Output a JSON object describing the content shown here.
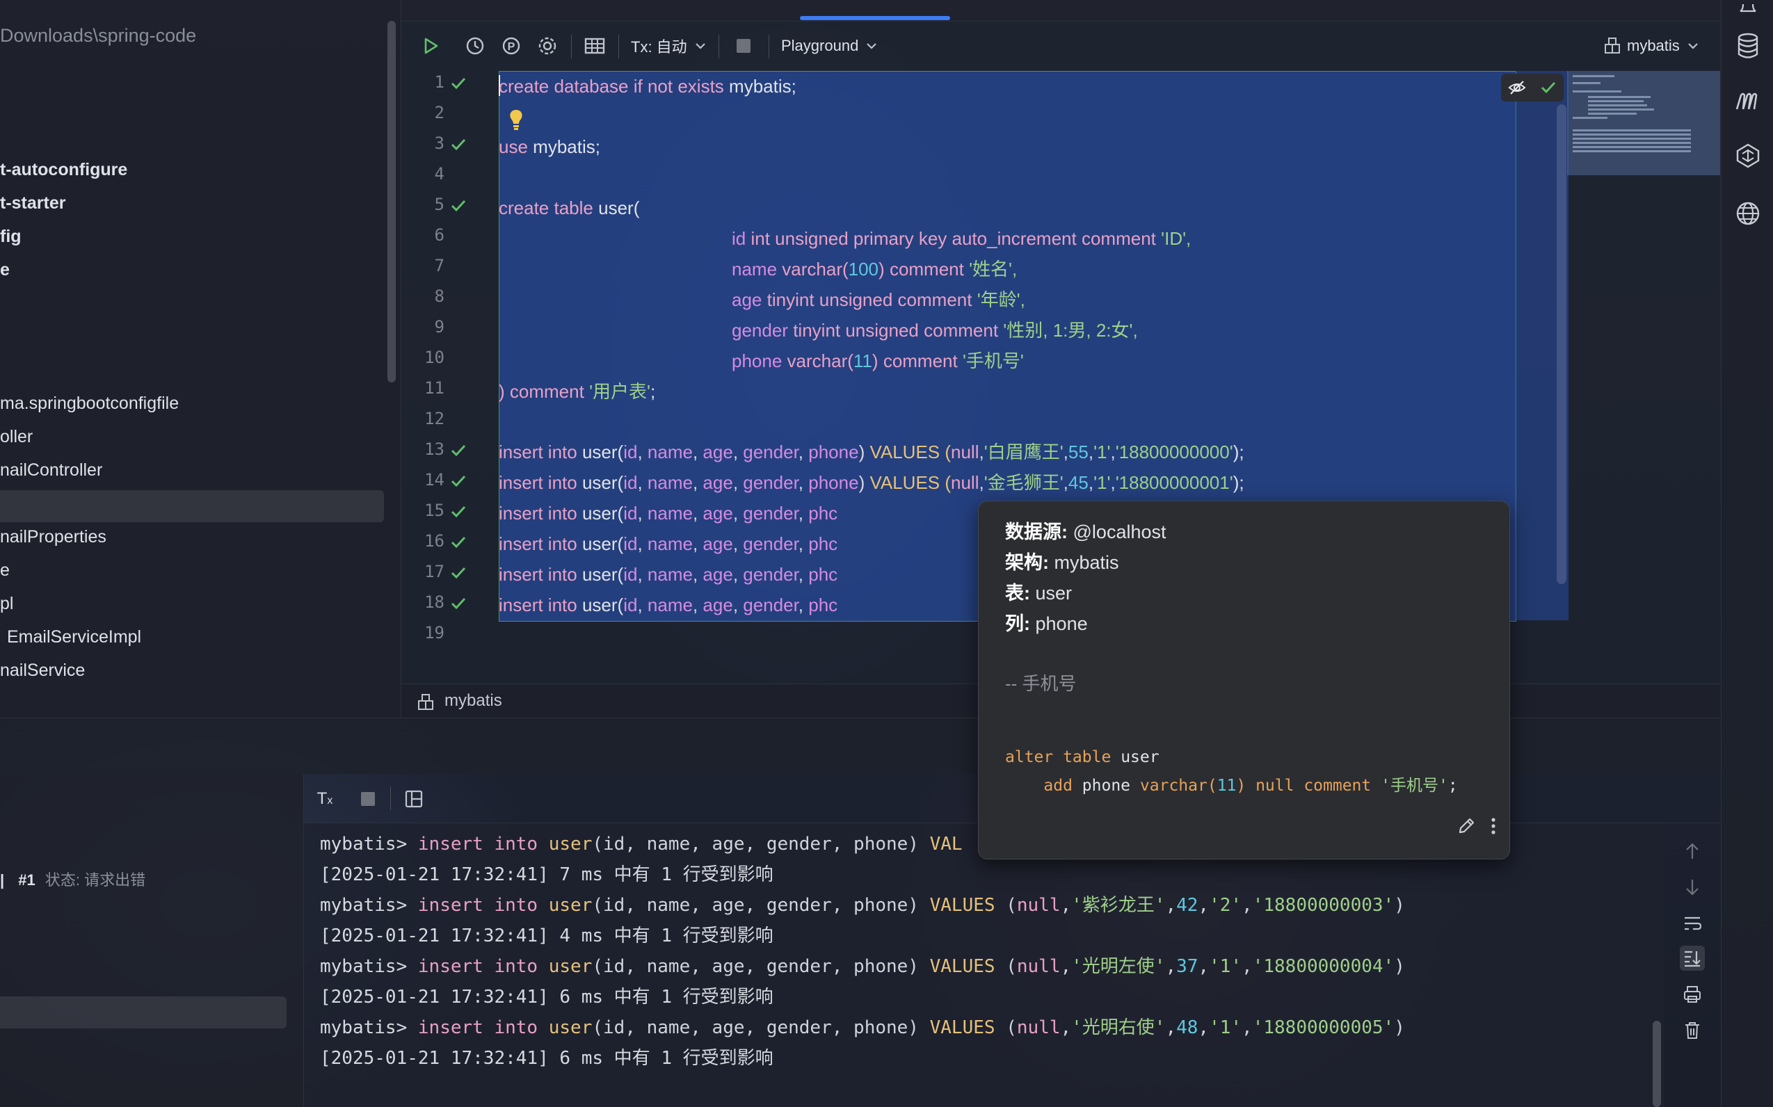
{
  "project": {
    "path": "Downloads\\spring-code",
    "items": [
      {
        "label": "t-autoconfigure",
        "bold": true
      },
      {
        "label": "t-starter",
        "bold": true
      },
      {
        "label": "fig",
        "bold": true
      },
      {
        "label": "e",
        "bold": true
      },
      {
        "label": "ma.springbootconfigfile",
        "bold": false
      },
      {
        "label": "oller",
        "bold": false
      },
      {
        "label": "nailController",
        "bold": false
      },
      {
        "label": "nailProperties",
        "bold": false
      },
      {
        "label": "e",
        "bold": false
      },
      {
        "label": "pl",
        "bold": false
      },
      {
        "label": "EmailServiceImpl",
        "bold": false
      },
      {
        "label": "nailService",
        "bold": false
      }
    ]
  },
  "toolbar": {
    "tx_label": "Tx: 自动",
    "playground_label": "Playground",
    "schema_label": "mybatis"
  },
  "editor": {
    "line_numbers": [
      "1",
      "2",
      "3",
      "4",
      "5",
      "6",
      "7",
      "8",
      "9",
      "10",
      "11",
      "12",
      "13",
      "14",
      "15",
      "16",
      "17",
      "18",
      "19"
    ],
    "checked_lines": [
      1,
      3,
      5,
      13,
      14,
      15,
      16,
      17,
      18
    ],
    "lines": {
      "l1": [
        "create",
        "database",
        "if",
        "not",
        "exists",
        "mybatis;"
      ],
      "l3": [
        "use",
        "mybatis;"
      ],
      "l5": [
        "create",
        "table",
        "user("
      ],
      "l6": {
        "indent": "          ",
        "name": "id",
        "type": "int unsigned primary key auto_increment",
        "kw": "comment",
        "str": "'ID',"
      },
      "l7": {
        "name": "name",
        "type": "varchar(",
        "num": "100",
        "close": ")",
        "kw": "comment",
        "str": "'姓名',"
      },
      "l8": {
        "name": "age",
        "type": "tinyint unsigned",
        "kw": "comment",
        "str": "'年龄',"
      },
      "l9": {
        "name": "gender",
        "type": "tinyint unsigned",
        "kw": "comment",
        "str": "'性别, 1:男, 2:女',"
      },
      "l10": {
        "name": "phone",
        "type": "varchar(",
        "num": "11",
        "close": ")",
        "kw": "comment",
        "str": "'手机号'"
      },
      "l11": {
        "close": ")",
        "kw": "comment",
        "str": "'用户表'",
        "end": ";"
      },
      "insert_prefix": "insert into",
      "insert_table": "user(",
      "insert_cols": [
        "id",
        "name",
        "age",
        "gender",
        "phone"
      ],
      "l13": {
        "values": "VALUES (",
        "null": "null",
        "name": "'白眉鹰王'",
        "age": "55",
        "gender": "'1'",
        "phone": "'18800000000'",
        "end": ");"
      },
      "l14": {
        "values": "VALUES (",
        "null": "null",
        "name": "'金毛狮王'",
        "age": "45",
        "gender": "'1'",
        "phone": "'18800000001'",
        "end": ");"
      },
      "truncated_col": "phc"
    },
    "breadcrumb": "mybatis"
  },
  "popup": {
    "datasource_label": "数据源:",
    "datasource_value": "@localhost",
    "schema_label": "架构:",
    "schema_value": "mybatis",
    "table_label": "表:",
    "table_value": "user",
    "column_label": "列:",
    "column_value": "phone",
    "comment": "-- 手机号",
    "ddl_line1_kw": "alter table",
    "ddl_line1_id": "user",
    "ddl_line2_kw": "add",
    "ddl_line2_col": "phone",
    "ddl_line2_type": "varchar(",
    "ddl_line2_num": "11",
    "ddl_line2_rest": ") null comment",
    "ddl_line2_str": "'手机号'",
    "ddl_line2_end": ";"
  },
  "services": {
    "session_number": "#1",
    "session_status": "状态: 请求出错"
  },
  "console": {
    "prompt": "mybatis>",
    "insert_kw": "insert into",
    "insert_fn": "user",
    "insert_cols": "(id, name, age, gender, phone)",
    "lines": [
      {
        "type": "cmd",
        "truncated": true,
        "values_prefix": "VAL"
      },
      {
        "type": "result",
        "ts": "[2025-01-21 17:32:41]",
        "ms": "7 ms",
        "msg": "中有 1 行受到影响"
      },
      {
        "type": "cmd",
        "null": "null",
        "name": "'紫衫龙王'",
        "age": "42",
        "gender": "'2'",
        "phone": "'18800000003'"
      },
      {
        "type": "result",
        "ts": "[2025-01-21 17:32:41]",
        "ms": "4 ms",
        "msg": "中有 1 行受到影响"
      },
      {
        "type": "cmd",
        "null": "null",
        "name": "'光明左使'",
        "age": "37",
        "gender": "'1'",
        "phone": "'18800000004'"
      },
      {
        "type": "result",
        "ts": "[2025-01-21 17:32:41]",
        "ms": "6 ms",
        "msg": "中有 1 行受到影响"
      },
      {
        "type": "cmd",
        "null": "null",
        "name": "'光明右使'",
        "age": "48",
        "gender": "'1'",
        "phone": "'18800000005'"
      },
      {
        "type": "result",
        "ts": "[2025-01-21 17:32:41]",
        "ms": "6 ms",
        "msg": "中有 1 行受到影响"
      }
    ],
    "values_kw": "VALUES"
  },
  "icons": {
    "run": "play-icon",
    "history": "clock-icon",
    "explain": "p-circle-icon",
    "settings": "gear-icon",
    "table": "table-icon",
    "stop": "stop-icon",
    "database": "database-icon",
    "maven": "maven-icon",
    "ai": "ai-assistant-icon",
    "globe": "globe-icon"
  },
  "colors": {
    "selection": "#2850af",
    "accent_tab": "#3d7bf4",
    "check": "#5fbf6a"
  }
}
